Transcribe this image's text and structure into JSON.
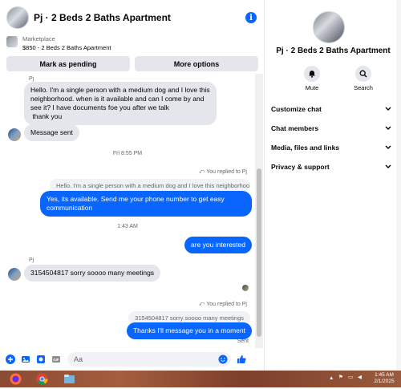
{
  "header": {
    "title": "Pj · 2 Beds 2 Baths Apartment"
  },
  "marketplace": {
    "label": "Marketplace",
    "listing": "$850 - 2 Beds 2 Baths Apartment",
    "mark_pending": "Mark as pending",
    "more_options": "More options"
  },
  "messages": {
    "sender1": "Pj",
    "msg1": "Hello. I'm a single person with a medium dog and I love this neighborhood. when is it available and can I come by and see it? I have documents foe you after we talk\n thank you",
    "msg2": "Message sent",
    "time1": "Fri 8:55 PM",
    "replied1": "You replied to Pj",
    "reply_ref1": "Hello. I'm a single person with a medium dog and I love this neighborhoo...",
    "out1": "Yes, its available. Send me your phone number to get easy communication",
    "time2": "1:43 AM",
    "out2": "are you interested",
    "sender2": "Pj",
    "msg3": "3154504817  sorry  soooo many meetings",
    "replied2": "You replied to Pj",
    "reply_ref2": "3154504817  sorry  soooo many meetings",
    "out3": "Thanks I'll message you in a moment",
    "status": "Sent"
  },
  "composer": {
    "placeholder": "Aa"
  },
  "sidebar": {
    "title": "Pj · 2 Beds 2 Baths Apartment",
    "mute": "Mute",
    "search": "Search",
    "items": [
      {
        "label": "Customize chat"
      },
      {
        "label": "Chat members"
      },
      {
        "label": "Media, files and links"
      },
      {
        "label": "Privacy & support"
      }
    ]
  },
  "taskbar": {
    "time": "1:45 AM",
    "date": "2/1/2025"
  },
  "colors": {
    "accent": "#0866ff",
    "bubble_in": "#e4e6eb"
  }
}
